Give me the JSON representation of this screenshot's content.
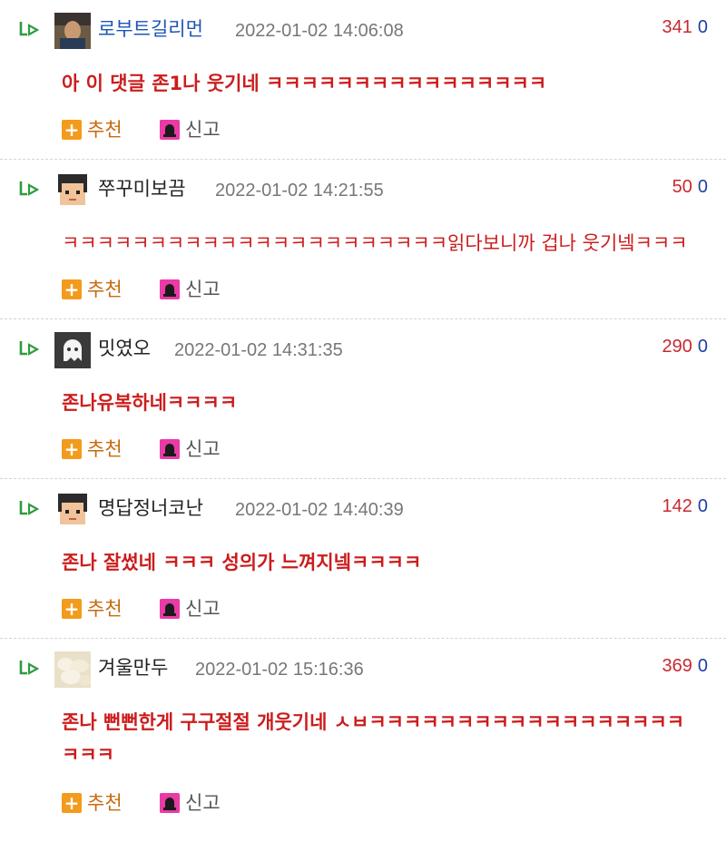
{
  "comments": [
    {
      "nickname": "로부트길리먼",
      "timestamp": "2022-01-02 14:06:08",
      "upvotes": "341",
      "downvotes": "0",
      "text": "아 이 댓글 존1나 웃기네 ㅋㅋㅋㅋㅋㅋㅋㅋㅋㅋㅋㅋㅋㅋㅋㅋ",
      "recommend_label": "추천",
      "report_label": "신고",
      "avatar": "photo-avatar",
      "nick_color": "#1d55b5"
    },
    {
      "nickname": "쭈꾸미보끔",
      "timestamp": "2022-01-02 14:21:55",
      "upvotes": "50",
      "downvotes": "0",
      "text": "ㅋㅋㅋㅋㅋㅋㅋㅋㅋㅋㅋㅋㅋㅋㅋㅋㅋㅋㅋㅋㅋㅋ읽다보니까 겁나 웃기넼ㅋㅋㅋ",
      "recommend_label": "추천",
      "report_label": "신고",
      "avatar": "pixel-face-avatar",
      "nick_color": "#222222"
    },
    {
      "nickname": "밋였오",
      "timestamp": "2022-01-02 14:31:35",
      "upvotes": "290",
      "downvotes": "0",
      "text": "존나유복하네ㅋㅋㅋㅋ",
      "recommend_label": "추천",
      "report_label": "신고",
      "avatar": "ghost-avatar",
      "nick_color": "#222222"
    },
    {
      "nickname": "명답정너코난",
      "timestamp": "2022-01-02 14:40:39",
      "upvotes": "142",
      "downvotes": "0",
      "text": "존나 잘썼네 ㅋㅋㅋ 성의가 느껴지넼ㅋㅋㅋㅋ",
      "recommend_label": "추천",
      "report_label": "신고",
      "avatar": "pixel-face-avatar",
      "nick_color": "#222222"
    },
    {
      "nickname": "겨울만두",
      "timestamp": "2022-01-02 15:16:36",
      "upvotes": "369",
      "downvotes": "0",
      "text": "존나 뻔뻔한게 구구절절 개웃기네 ㅅㅂㅋㅋㅋㅋㅋㅋㅋㅋㅋㅋㅋㅋㅋㅋㅋㅋㅋㅋㅋㅋㅋ",
      "recommend_label": "추천",
      "report_label": "신고",
      "avatar": "photo-avatar",
      "nick_color": "#222222"
    }
  ]
}
